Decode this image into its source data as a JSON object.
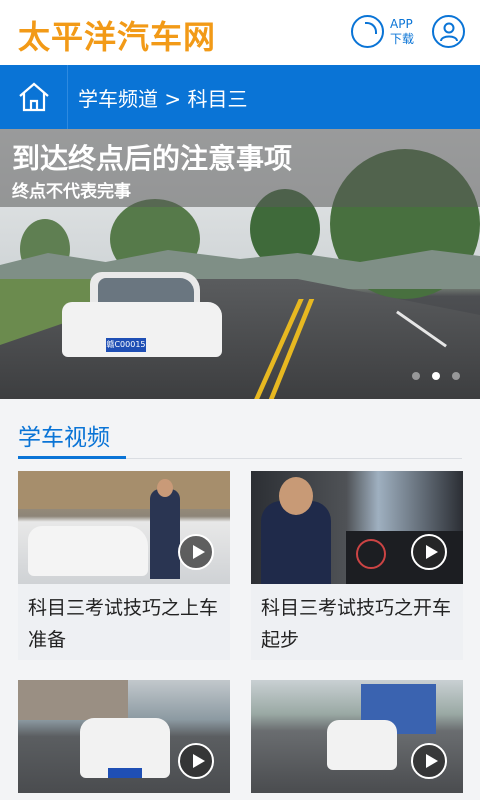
{
  "header": {
    "logo_text": "太平洋汽车网",
    "app_label_top": "APP",
    "app_label_bottom": "下载"
  },
  "nav": {
    "breadcrumb": "学车频道 > 科目三"
  },
  "banner": {
    "title": "到达终点后的注意事项",
    "subtitle": "终点不代表完事",
    "plate": "赣C00015",
    "pagination": {
      "count": 3,
      "active_index": 1
    }
  },
  "section": {
    "title": "学车视频"
  },
  "videos": [
    {
      "title": "科目三考试技巧之上车准备"
    },
    {
      "title": "科目三考试技巧之开车起步"
    },
    {
      "title": ""
    },
    {
      "title": ""
    }
  ],
  "colors": {
    "brand_orange": "#f29a17",
    "brand_blue": "#0a74d6"
  }
}
